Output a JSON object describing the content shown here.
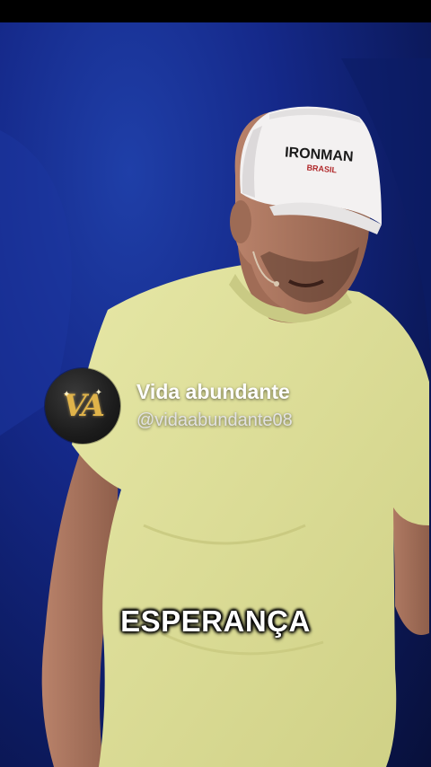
{
  "channel": {
    "name": "Vida abundante",
    "handle": "@vidaabundante08",
    "avatar_monogram": "VA"
  },
  "video": {
    "caption": "ESPERANÇA",
    "cap_logo_text": "IRONMAN",
    "cap_sub_text": "BRASIL"
  },
  "colors": {
    "background": "#14288a",
    "shirt": "#dfe09a",
    "avatar_gold": "#e0b34a"
  }
}
